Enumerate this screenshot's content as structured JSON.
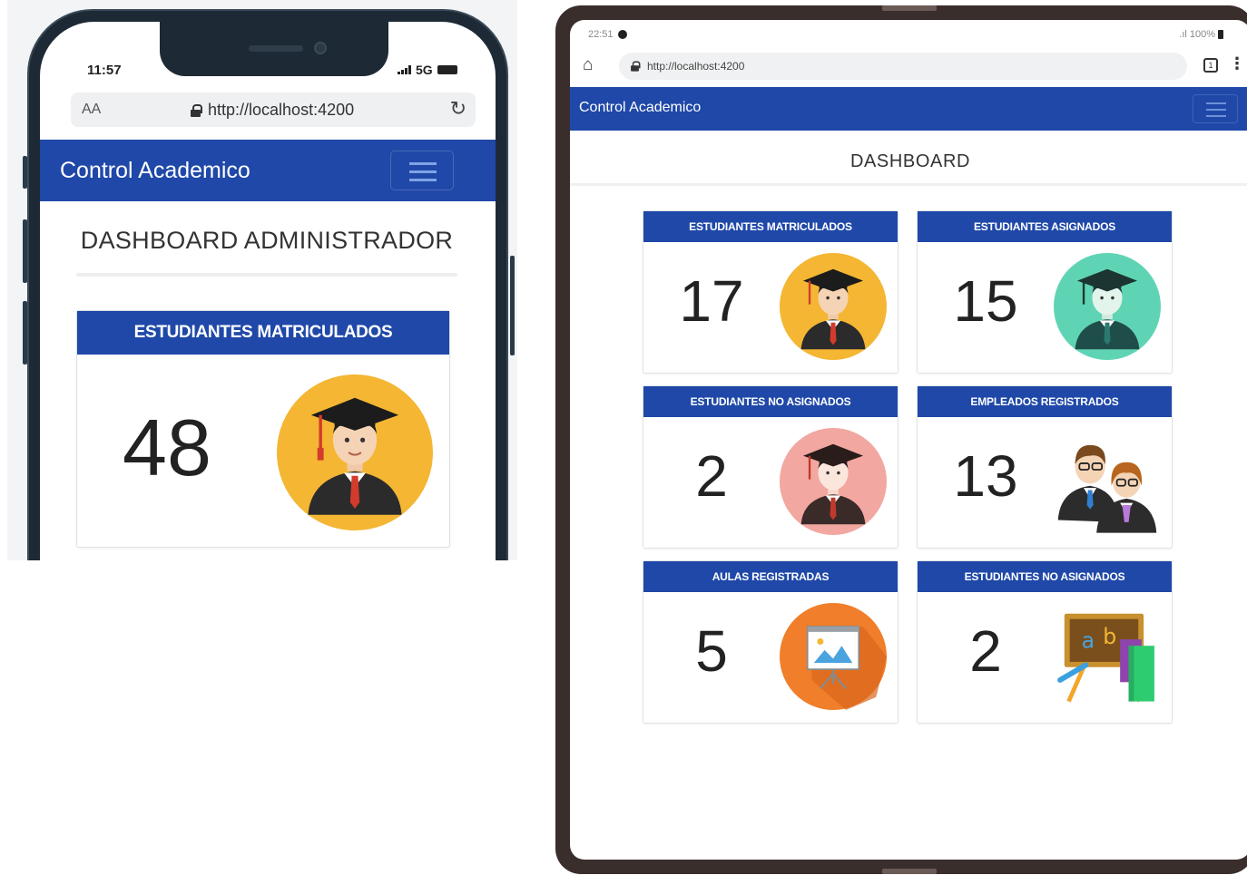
{
  "phone": {
    "status": {
      "time": "11:57",
      "network": "5G"
    },
    "browser": {
      "text_size_label": "AA",
      "url": "http://localhost:4200"
    },
    "navbar": {
      "brand": "Control Academico"
    },
    "page_title": "DASHBOARD ADMINISTRADOR",
    "card": {
      "title": "ESTUDIANTES MATRICULADOS",
      "value": "48",
      "icon": "graduate-student-icon",
      "icon_bg": "#f4b633"
    }
  },
  "tablet": {
    "status": {
      "time": "22:51",
      "battery": "100%"
    },
    "browser": {
      "url": "http://localhost:4200",
      "tabs_count": "1"
    },
    "navbar": {
      "brand": "Control Academico"
    },
    "page_title": "DASHBOARD",
    "cards": [
      {
        "title": "ESTUDIANTES MATRICULADOS",
        "value": "17",
        "icon": "graduate-student-icon",
        "icon_bg": "#f4b633"
      },
      {
        "title": "ESTUDIANTES ASIGNADOS",
        "value": "15",
        "icon": "graduate-student-icon",
        "icon_bg": "#5fd4b4"
      },
      {
        "title": "ESTUDIANTES NO ASIGNADOS",
        "value": "2",
        "icon": "graduate-student-icon",
        "icon_bg": "#f2a7a0"
      },
      {
        "title": "EMPLEADOS REGISTRADOS",
        "value": "13",
        "icon": "employees-icon",
        "icon_bg": ""
      },
      {
        "title": "AULAS REGISTRADAS",
        "value": "5",
        "icon": "presentation-board-icon",
        "icon_bg": "#f07e2a"
      },
      {
        "title": "ESTUDIANTES NO ASIGNADOS",
        "value": "2",
        "icon": "chalkboard-books-icon",
        "icon_bg": ""
      }
    ]
  },
  "colors": {
    "primary": "#1f48a8",
    "text": "#222222"
  }
}
